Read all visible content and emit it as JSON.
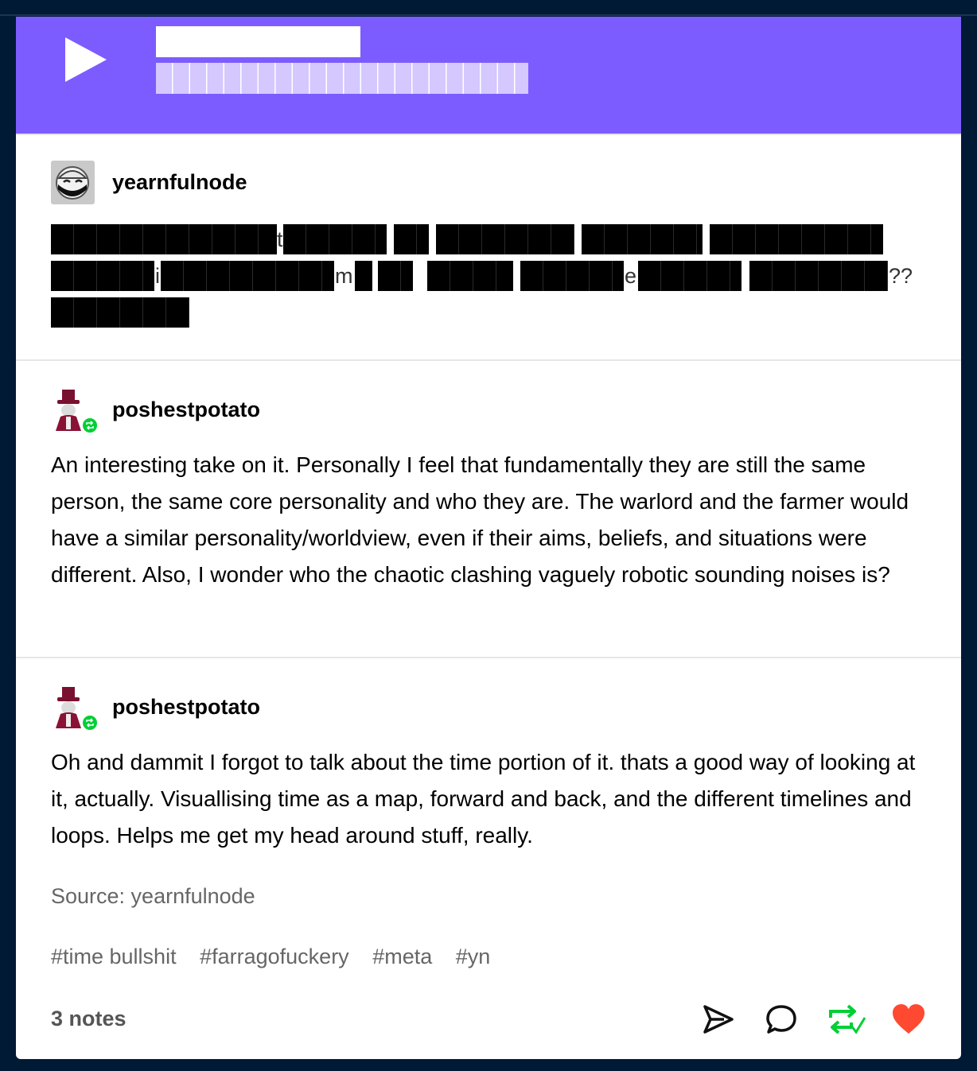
{
  "audio": {
    "play_icon": "play-icon"
  },
  "posts": [
    {
      "username": "yearnfulnode",
      "redacted_lines": [
        {
          "visible_chars": [
            "t"
          ]
        },
        {
          "visible_chars": [
            "i",
            "m",
            "e",
            "??"
          ]
        }
      ]
    },
    {
      "username": "poshestpotato",
      "body": "An interesting take on it. Personally I feel that fundamentally they are still the same person, the same core personality and who they are. The warlord and the farmer would have a similar personality/worldview, even if their aims, beliefs, and situations were different. Also, I wonder who the chaotic clashing vaguely robotic sounding noises is?"
    },
    {
      "username": "poshestpotato",
      "body": "Oh and dammit I forgot to talk about the time portion of it. thats a good way of looking at it, actually. Visuallising time as a map, forward and back, and the different timelines and loops. Helps me get my head around stuff, really.",
      "source": "Source: yearnfulnode",
      "tags": [
        "#time bullshit",
        "#farragofuckery",
        "#meta",
        "#yn"
      ],
      "notes": "3 notes"
    }
  ],
  "actions": {
    "share_icon": "send-icon",
    "reply_icon": "comment-icon",
    "reblog_icon": "reblog-check-icon",
    "like_icon": "heart-icon"
  },
  "colors": {
    "audio_header": "#7c5cff",
    "reblog_green": "#00cf35",
    "like_red": "#ff4930",
    "page_background": "#001935"
  }
}
